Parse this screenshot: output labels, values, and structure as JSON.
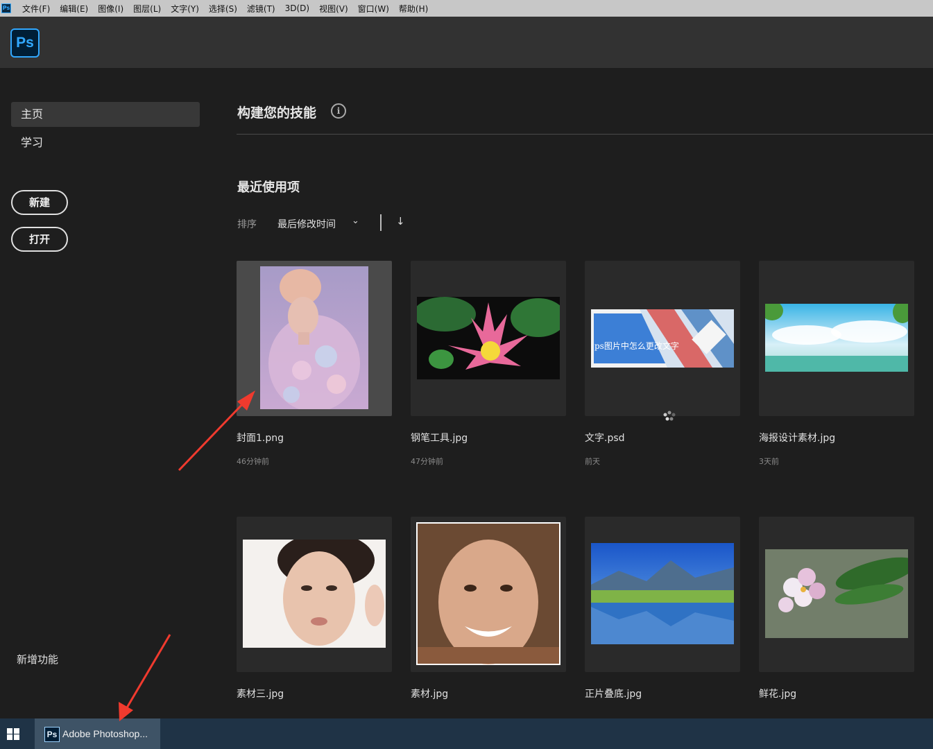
{
  "menubar": {
    "app_icon": "Ps",
    "items": [
      "文件(F)",
      "编辑(E)",
      "图像(I)",
      "图层(L)",
      "文字(Y)",
      "选择(S)",
      "滤镜(T)",
      "3D(D)",
      "视图(V)",
      "窗口(W)",
      "帮助(H)"
    ]
  },
  "logo": "Ps",
  "sidebar": {
    "nav": [
      {
        "label": "主页",
        "active": true
      },
      {
        "label": "学习",
        "active": false
      }
    ],
    "new_button": "新建",
    "open_button": "打开",
    "whats_new": "新增功能"
  },
  "main": {
    "skills_title": "构建您的技能",
    "info_icon": "info-icon",
    "recent_title": "最近使用项",
    "sort_label": "排序",
    "sort_value": "最后修改时间",
    "sort_direction_icon": "arrow-down-icon"
  },
  "files": [
    {
      "name": "封面1.png",
      "time": "46分钟前",
      "thumb": "portrait-pastel",
      "selected": true
    },
    {
      "name": "钢笔工具.jpg",
      "time": "47分钟前",
      "thumb": "lotus"
    },
    {
      "name": "文字.psd",
      "time": "前天",
      "thumb": "banner",
      "thumb_text": "ps图片中怎么更改文字"
    },
    {
      "name": "海报设计素材.jpg",
      "time": "3天前",
      "thumb": "sky"
    },
    {
      "name": "素材三.jpg",
      "time": "",
      "thumb": "woman-face"
    },
    {
      "name": "素材.jpg",
      "time": "",
      "thumb": "smiling-face"
    },
    {
      "name": "正片叠底.jpg",
      "time": "",
      "thumb": "lake"
    },
    {
      "name": "鲜花.jpg",
      "time": "",
      "thumb": "flowers"
    }
  ],
  "taskbar": {
    "start_icon": "windows-icon",
    "task_icon": "Ps",
    "task_label": "Adobe Photoshop..."
  },
  "colors": {
    "accent": "#31a8ff",
    "background": "#1e1e1e",
    "annotation_arrow": "#f03a2e"
  }
}
